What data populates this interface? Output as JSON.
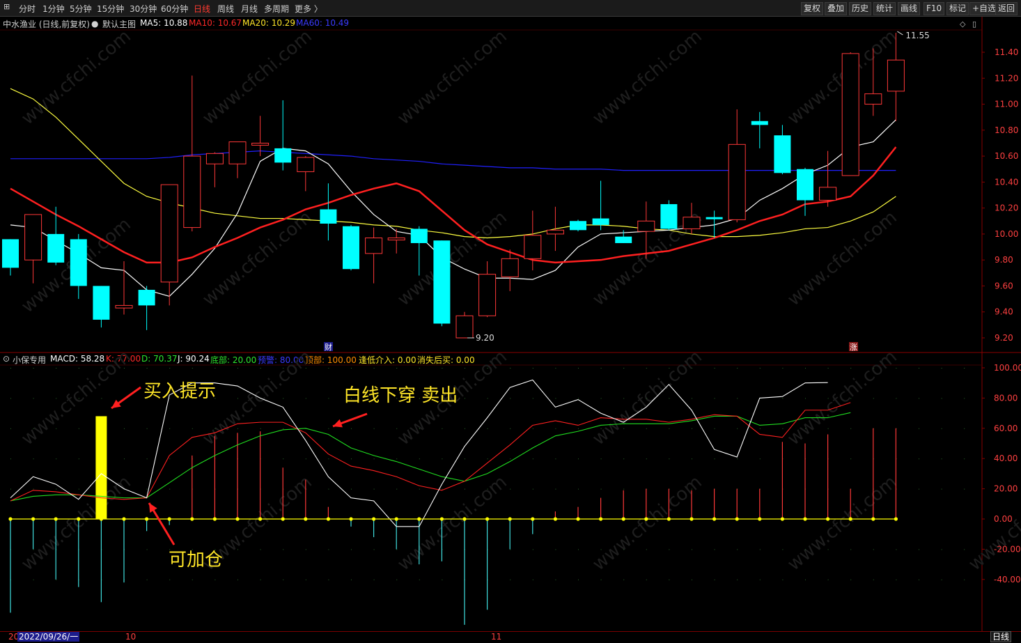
{
  "toolbar": {
    "periods": [
      "分时",
      "1分钟",
      "5分钟",
      "15分钟",
      "30分钟",
      "60分钟",
      "日线",
      "周线",
      "月线",
      "多周期",
      "更多 〉"
    ],
    "active_period": "日线",
    "right_buttons": [
      "复权",
      "叠加",
      "历史",
      "统计",
      "画线",
      "F10",
      "标记",
      "+自选",
      "返回"
    ]
  },
  "kline_info": {
    "stock": "中水渔业 (日线,前复权)",
    "template": "默认主图",
    "ma5": "MA5: 10.88",
    "ma10": "MA10: 10.67",
    "ma20": "MA20: 10.29",
    "ma60": "MA60: 10.49"
  },
  "indicator_info": {
    "name": "小保专用",
    "macd": "MACD: 58.28",
    "k": "K: 77.00",
    "d": "D: 70.37",
    "j": "J: 90.24",
    "bottom": "底部: 20.00",
    "warn": "预警: 80.00",
    "top": "顶部: 100.00",
    "buy_low": "逢低介入: 0.00",
    "vanish": "消失后买: 0.00"
  },
  "annotations": {
    "buy": "买入提示",
    "sell": "白线下穿 卖出",
    "add": "可加仓"
  },
  "markers": {
    "finance": "财",
    "limit_up": "涨"
  },
  "price_labels": {
    "high": "11.55",
    "low": "9.20"
  },
  "dates": {
    "current": "2022/09/26/一",
    "left_stub": "20",
    "month10": "10",
    "month11": "11"
  },
  "footer": {
    "period": "日线"
  },
  "watermark": "www.cfchi.com",
  "colors": {
    "up": "#ff3838",
    "down": "#00ffff",
    "ma5": "#ffffff",
    "ma10": "#ff2020",
    "ma20": "#ffff40",
    "ma60": "#2020ff",
    "k": "#ff2020",
    "d": "#20e020",
    "j": "#ffffff",
    "signal": "#ffff00"
  },
  "chart_data": {
    "type": "candlestick",
    "price_axis": {
      "ticks": [
        9.2,
        9.4,
        9.6,
        9.8,
        10.0,
        10.2,
        10.4,
        10.6,
        10.8,
        11.0,
        11.2,
        11.4
      ],
      "range": [
        9.12,
        11.62
      ]
    },
    "indicator_axis": {
      "ticks": [
        -40,
        -20,
        0,
        20,
        40,
        60,
        80,
        100
      ],
      "range": [
        -75,
        110
      ]
    },
    "candles": [
      {
        "o": 9.96,
        "h": 9.96,
        "l": 9.68,
        "c": 9.74
      },
      {
        "o": 9.8,
        "h": 10.15,
        "l": 9.62,
        "c": 10.15
      },
      {
        "o": 10.0,
        "h": 10.21,
        "l": 9.76,
        "c": 9.78
      },
      {
        "o": 9.96,
        "h": 10.0,
        "l": 9.5,
        "c": 9.6
      },
      {
        "o": 9.6,
        "h": 9.6,
        "l": 9.28,
        "c": 9.34
      },
      {
        "o": 9.43,
        "h": 9.79,
        "l": 9.38,
        "c": 9.45
      },
      {
        "o": 9.57,
        "h": 9.6,
        "l": 9.26,
        "c": 9.45
      },
      {
        "o": 9.63,
        "h": 10.38,
        "l": 9.45,
        "c": 10.38
      },
      {
        "o": 10.05,
        "h": 11.22,
        "l": 10.02,
        "c": 10.6
      },
      {
        "o": 10.54,
        "h": 10.63,
        "l": 10.36,
        "c": 10.62
      },
      {
        "o": 10.54,
        "h": 10.71,
        "l": 10.43,
        "c": 10.71
      },
      {
        "o": 10.69,
        "h": 10.91,
        "l": 10.6,
        "c": 10.7
      },
      {
        "o": 10.66,
        "h": 11.03,
        "l": 10.49,
        "c": 10.55
      },
      {
        "o": 10.48,
        "h": 10.6,
        "l": 10.33,
        "c": 10.59
      },
      {
        "o": 10.19,
        "h": 10.39,
        "l": 9.95,
        "c": 10.08
      },
      {
        "o": 10.06,
        "h": 10.07,
        "l": 9.72,
        "c": 9.73
      },
      {
        "o": 9.85,
        "h": 10.05,
        "l": 9.62,
        "c": 9.97
      },
      {
        "o": 9.96,
        "h": 10.04,
        "l": 9.85,
        "c": 9.97
      },
      {
        "o": 10.04,
        "h": 10.06,
        "l": 9.68,
        "c": 9.93
      },
      {
        "o": 9.95,
        "h": 9.95,
        "l": 9.29,
        "c": 9.31
      },
      {
        "o": 9.2,
        "h": 9.4,
        "l": 9.2,
        "c": 9.37
      },
      {
        "o": 9.37,
        "h": 9.79,
        "l": 9.36,
        "c": 9.69
      },
      {
        "o": 9.67,
        "h": 9.88,
        "l": 9.56,
        "c": 9.81
      },
      {
        "o": 9.81,
        "h": 10.18,
        "l": 9.72,
        "c": 9.99
      },
      {
        "o": 10.0,
        "h": 10.21,
        "l": 9.87,
        "c": 10.03
      },
      {
        "o": 10.1,
        "h": 10.11,
        "l": 10.02,
        "c": 10.03
      },
      {
        "o": 10.12,
        "h": 10.41,
        "l": 10.03,
        "c": 10.07
      },
      {
        "o": 9.98,
        "h": 10.03,
        "l": 9.93,
        "c": 9.93
      },
      {
        "o": 10.02,
        "h": 10.25,
        "l": 9.81,
        "c": 10.1
      },
      {
        "o": 10.23,
        "h": 10.26,
        "l": 10.03,
        "c": 10.04
      },
      {
        "o": 10.04,
        "h": 10.24,
        "l": 10.0,
        "c": 10.13
      },
      {
        "o": 10.13,
        "h": 10.18,
        "l": 9.97,
        "c": 10.12
      },
      {
        "o": 10.11,
        "h": 10.96,
        "l": 10.09,
        "c": 10.69
      },
      {
        "o": 10.87,
        "h": 10.94,
        "l": 10.66,
        "c": 10.84
      },
      {
        "o": 10.76,
        "h": 10.84,
        "l": 10.46,
        "c": 10.47
      },
      {
        "o": 10.5,
        "h": 10.51,
        "l": 10.14,
        "c": 10.26
      },
      {
        "o": 10.26,
        "h": 10.64,
        "l": 10.21,
        "c": 10.36
      },
      {
        "o": 10.45,
        "h": 11.4,
        "l": 10.45,
        "c": 11.39
      },
      {
        "o": 11.0,
        "h": 11.43,
        "l": 10.91,
        "c": 11.08
      },
      {
        "o": 11.1,
        "h": 11.55,
        "l": 10.87,
        "c": 11.34
      }
    ],
    "ma5": [
      10.07,
      10.05,
      9.95,
      9.85,
      9.74,
      9.72,
      9.57,
      9.52,
      9.69,
      9.89,
      10.16,
      10.56,
      10.66,
      10.64,
      10.54,
      10.33,
      10.15,
      10.02,
      9.99,
      9.82,
      9.73,
      9.66,
      9.66,
      9.65,
      9.72,
      9.9,
      10.0,
      10.01,
      10.02,
      10.03,
      10.05,
      10.07,
      10.12,
      10.26,
      10.35,
      10.46,
      10.53,
      10.67,
      10.71,
      10.88
    ],
    "ma10": [
      10.35,
      10.25,
      10.15,
      10.06,
      9.96,
      9.86,
      9.78,
      9.78,
      9.82,
      9.9,
      9.97,
      10.05,
      10.11,
      10.19,
      10.24,
      10.3,
      10.35,
      10.39,
      10.33,
      10.18,
      10.03,
      9.92,
      9.86,
      9.8,
      9.78,
      9.79,
      9.8,
      9.83,
      9.85,
      9.87,
      9.92,
      9.97,
      10.03,
      10.1,
      10.15,
      10.23,
      10.25,
      10.29,
      10.45,
      10.67
    ],
    "ma20": [
      11.12,
      11.04,
      10.9,
      10.73,
      10.56,
      10.39,
      10.29,
      10.24,
      10.2,
      10.16,
      10.14,
      10.12,
      10.12,
      10.11,
      10.1,
      10.09,
      10.07,
      10.06,
      10.03,
      10.01,
      9.98,
      9.97,
      9.98,
      10.0,
      10.04,
      10.07,
      10.07,
      10.06,
      10.04,
      10.03,
      10.0,
      9.98,
      9.98,
      9.99,
      10.01,
      10.04,
      10.05,
      10.1,
      10.17,
      10.29
    ],
    "ma60": [
      10.58,
      10.58,
      10.58,
      10.58,
      10.58,
      10.58,
      10.58,
      10.59,
      10.61,
      10.62,
      10.63,
      10.64,
      10.63,
      10.62,
      10.61,
      10.6,
      10.58,
      10.57,
      10.56,
      10.54,
      10.53,
      10.52,
      10.51,
      10.51,
      10.5,
      10.5,
      10.5,
      10.49,
      10.49,
      10.49,
      10.49,
      10.49,
      10.49,
      10.49,
      10.49,
      10.49,
      10.49,
      10.49,
      10.49,
      10.49
    ],
    "macd_bars": [
      -62,
      -20,
      -40,
      -45,
      -55,
      -42,
      -8,
      -4,
      42,
      55,
      57,
      58,
      34,
      26,
      8,
      -5,
      -12,
      -20,
      -30,
      -28,
      -70,
      -60,
      -20,
      -10,
      5,
      8,
      14,
      19,
      20,
      20,
      19,
      20,
      20,
      20,
      51,
      50,
      56,
      20,
      60,
      60
    ],
    "k": [
      12,
      19,
      18,
      16,
      14,
      13,
      14,
      42,
      54,
      57,
      63,
      64,
      64,
      57,
      43,
      35,
      32,
      28,
      22,
      19,
      25,
      37,
      49,
      62,
      65,
      62,
      67,
      66,
      66,
      64,
      66,
      69,
      68,
      56,
      54,
      72,
      72,
      77
    ],
    "d": [
      12,
      15,
      16,
      16,
      15,
      14,
      14,
      24,
      34,
      42,
      49,
      55,
      59,
      60,
      56,
      47,
      42,
      38,
      33,
      28,
      25,
      30,
      38,
      47,
      55,
      58,
      62,
      63,
      63,
      63,
      65,
      68,
      68,
      62,
      63,
      67,
      67,
      70.37
    ],
    "j": [
      14,
      28,
      23,
      13,
      30,
      20,
      14,
      82,
      90,
      90,
      88,
      80,
      74,
      52,
      28,
      14,
      12,
      -5,
      -5,
      23,
      48,
      67,
      87,
      92,
      74,
      79,
      70,
      64,
      74,
      89,
      72,
      46,
      41,
      80,
      81,
      90,
      90.24
    ],
    "buy_signal_index": 4,
    "buy_signal_value": 68
  }
}
